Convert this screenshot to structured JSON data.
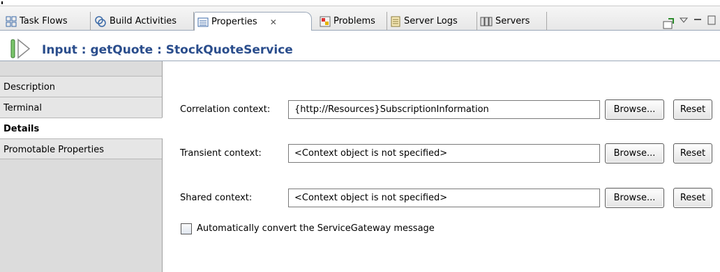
{
  "tabs": [
    {
      "label": "Task Flows",
      "icon": "task-flows-icon",
      "active": false
    },
    {
      "label": "Build Activities",
      "icon": "build-activities-icon",
      "active": false
    },
    {
      "label": "Properties",
      "icon": "properties-icon",
      "active": true
    },
    {
      "label": "Problems",
      "icon": "problems-icon",
      "active": false
    },
    {
      "label": "Server Logs",
      "icon": "server-logs-icon",
      "active": false
    },
    {
      "label": "Servers",
      "icon": "servers-icon",
      "active": false
    }
  ],
  "close_glyph": "✕",
  "header": {
    "title": "Input : getQuote : StockQuoteService",
    "icon": "input-terminal-icon"
  },
  "sidebar": {
    "items": [
      {
        "label": "Description",
        "selected": false
      },
      {
        "label": "Terminal",
        "selected": false
      },
      {
        "label": "Details",
        "selected": true
      },
      {
        "label": "Promotable Properties",
        "selected": false
      }
    ]
  },
  "form": {
    "fields": [
      {
        "label": "Correlation context:",
        "value": "{http://Resources}SubscriptionInformation"
      },
      {
        "label": "Transient context:",
        "value": "<Context object is not specified>"
      },
      {
        "label": "Shared context:",
        "value": "<Context object is not specified>"
      }
    ],
    "browse_label": "Browse...",
    "reset_label": "Reset",
    "checkbox_label": "Automatically convert the ServiceGateway message",
    "checkbox_checked": false
  },
  "colors": {
    "title": "#2a4d8c",
    "accent_border": "#9aa7b8"
  }
}
